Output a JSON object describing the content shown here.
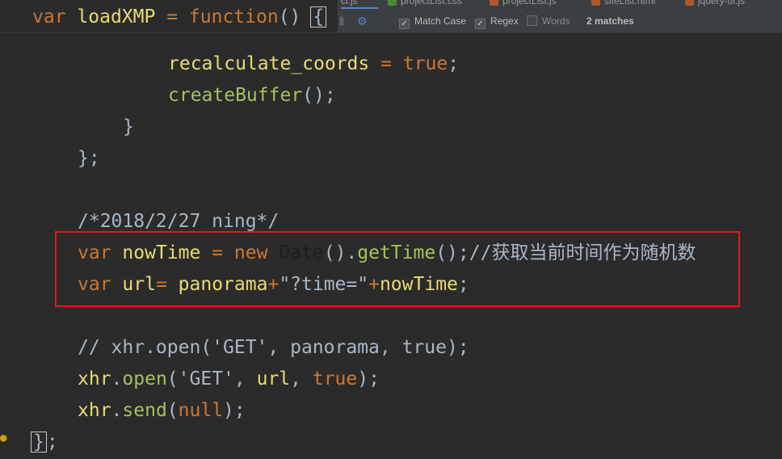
{
  "tabs": [
    {
      "label": "ci.js",
      "icon_color": "#b0a04a"
    },
    {
      "label": "projectList.css",
      "icon_color": "#4c8a36"
    },
    {
      "label": "projectList.js",
      "icon_color": "#b0582a"
    },
    {
      "label": "siteList.html",
      "icon_color": "#b0582a"
    },
    {
      "label": "jquery-ui.js",
      "icon_color": "#b0582a"
    }
  ],
  "find": {
    "match_case": {
      "label": "Match Case",
      "checked": true
    },
    "regex": {
      "label": "Regex",
      "checked": true
    },
    "words": {
      "label": "Words",
      "checked": false
    },
    "matches": "2 matches",
    "gear_icon": "gear-icon",
    "filter_icon": "filter-icon"
  },
  "code": {
    "line1": {
      "kw": "var",
      "name": "loadXMP",
      "eq": "=",
      "fn": "function",
      "paren": "()",
      "brace": "{"
    },
    "line2": {
      "name": "recalculate_coords",
      "eq": "=",
      "val": "true",
      "end": ";"
    },
    "line3": {
      "name": "createBuffer",
      "rest": "();"
    },
    "line4": "}",
    "line5": "};",
    "line6": "/*2018/2/27 ning*/",
    "line7": {
      "kw": "var",
      "name": "nowTime",
      "eq": "=",
      "new": "new",
      "cls": "Date",
      "p1": "().",
      "method": "getTime",
      "p2": "();",
      "comment": "//获取当前时间作为随机数"
    },
    "line8": {
      "kw": "var",
      "name": "url",
      "eq": "=",
      "v1": "panorama",
      "plus1": "+",
      "str": "\"?time=\"",
      "plus2": "+",
      "v2": "nowTime",
      "end": ";"
    },
    "line9": "// xhr.open('GET', panorama, true);",
    "line10": {
      "obj": "xhr",
      "dot": ".",
      "method": "open",
      "p1": "(",
      "str": "'GET'",
      "c1": ", ",
      "arg": "url",
      "c2": ", ",
      "val": "true",
      "p2": ");"
    },
    "line11": {
      "obj": "xhr",
      "dot": ".",
      "method": "send",
      "p1": "(",
      "val": "null",
      "p2": ");"
    },
    "line12": {
      "brace": "}",
      "end": ";"
    }
  },
  "colors": {
    "highlight_box": "#e0191b",
    "background": "#2b2b2b"
  }
}
